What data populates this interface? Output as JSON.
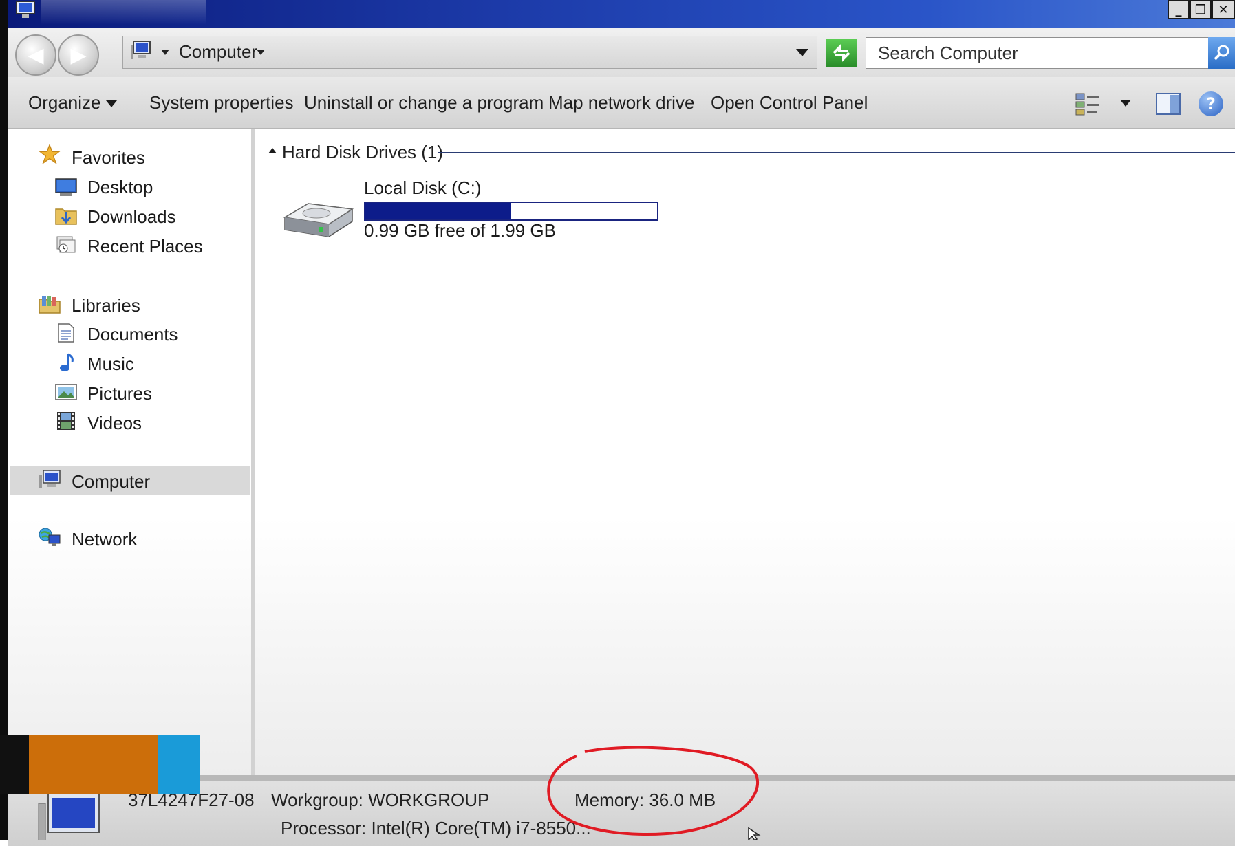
{
  "window": {
    "controls": {
      "minimize": "_",
      "restore": "❐",
      "close": "✕"
    }
  },
  "address_bar": {
    "location": "Computer",
    "back_glyph": "◀",
    "forward_glyph": "▶",
    "search_placeholder": "Search Computer"
  },
  "toolbar": {
    "organize": "Organize",
    "system_properties": "System properties",
    "uninstall": "Uninstall or change a program",
    "map_drive": "Map network drive",
    "control_panel": "Open Control Panel",
    "help_glyph": "?"
  },
  "nav": {
    "favorites": "Favorites",
    "desktop": "Desktop",
    "downloads": "Downloads",
    "recent": "Recent Places",
    "libraries": "Libraries",
    "documents": "Documents",
    "music": "Music",
    "pictures": "Pictures",
    "videos": "Videos",
    "computer": "Computer",
    "network": "Network"
  },
  "content": {
    "group_header": "Hard Disk Drives (1)",
    "drive": {
      "label": "Local Disk (C:)",
      "free_text": "0.99 GB free of 1.99 GB",
      "used_fraction": 0.5
    }
  },
  "details": {
    "computer_name": "37L4247F27-08",
    "workgroup": "Workgroup: WORKGROUP",
    "memory": "Memory: 36.0 MB",
    "processor": "Processor: Intel(R) Core(TM) i7-8550..."
  },
  "colors": {
    "drive_bar_fill": "#0d1c8a",
    "annotation": "#e01b24"
  }
}
